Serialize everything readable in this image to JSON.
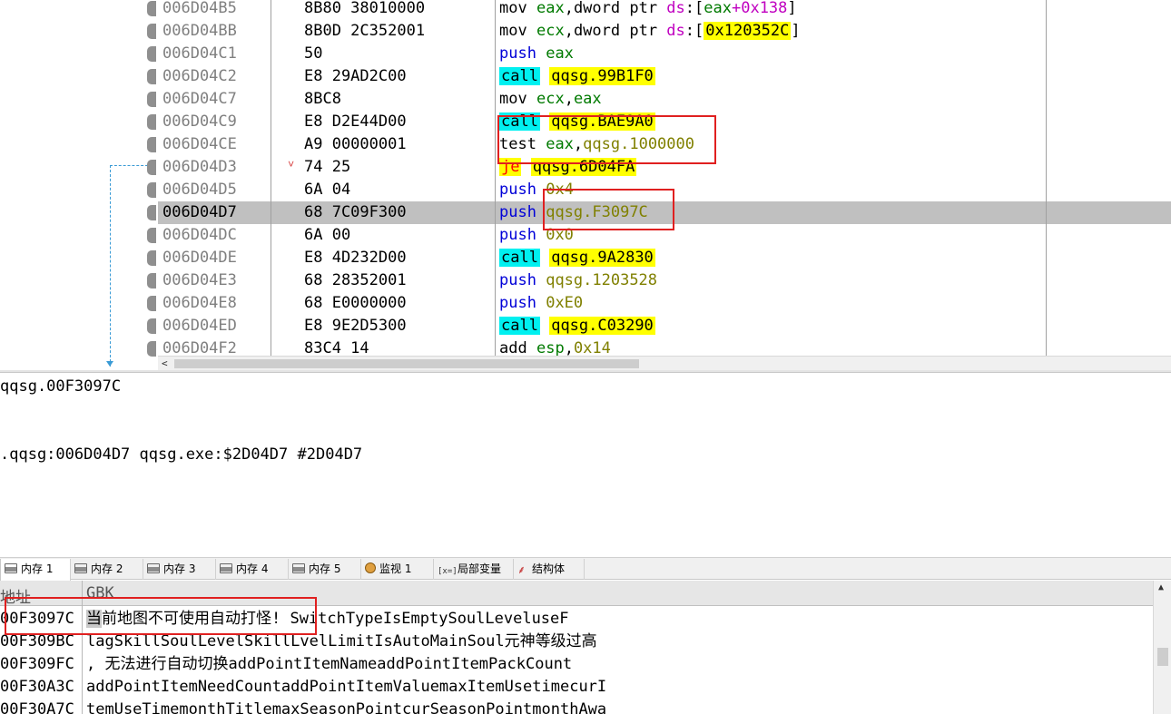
{
  "disasm": {
    "rows": [
      {
        "addr": "006D04B5",
        "bytes": "8B80 38010000",
        "mn": "mov",
        "mn_style": "plain",
        "ops": [
          [
            "eax",
            "reg"
          ],
          [
            ",",
            "br"
          ],
          [
            "dword ptr ",
            "br"
          ],
          [
            "ds",
            "seg"
          ],
          [
            ":[",
            "br"
          ],
          [
            "eax",
            "reg"
          ],
          [
            "+0x138",
            "seg"
          ],
          [
            "]",
            "br"
          ]
        ]
      },
      {
        "addr": "006D04BB",
        "bytes": "8B0D 2C352001",
        "mn": "mov",
        "mn_style": "plain",
        "ops": [
          [
            "ecx",
            "reg"
          ],
          [
            ",",
            "br"
          ],
          [
            "dword ptr ",
            "br"
          ],
          [
            "ds",
            "seg"
          ],
          [
            ":[",
            "br"
          ],
          [
            "0x120352C",
            "sym-y"
          ],
          [
            "]",
            "br"
          ]
        ]
      },
      {
        "addr": "006D04C1",
        "bytes": "50",
        "mn": "push",
        "mn_style": "push",
        "ops": [
          [
            "eax",
            "reg"
          ]
        ]
      },
      {
        "addr": "006D04C2",
        "bytes": "E8 29AD2C00",
        "mn": "call",
        "mn_style": "call",
        "ops": [
          [
            "qqsg.99B1F0",
            "sym-y"
          ]
        ]
      },
      {
        "addr": "006D04C7",
        "bytes": "8BC8",
        "mn": "mov",
        "mn_style": "plain",
        "ops": [
          [
            "ecx",
            "reg"
          ],
          [
            ",",
            "br"
          ],
          [
            "eax",
            "reg"
          ]
        ]
      },
      {
        "addr": "006D04C9",
        "bytes": "E8 D2E44D00",
        "mn": "call",
        "mn_style": "call",
        "ops": [
          [
            "qqsg.BAE9A0",
            "sym-y"
          ]
        ]
      },
      {
        "addr": "006D04CE",
        "bytes": "A9 00000001",
        "mn": "test",
        "mn_style": "plain",
        "ops": [
          [
            "eax",
            "reg"
          ],
          [
            ",",
            "br"
          ],
          [
            "qqsg.1000000",
            "sym-o"
          ]
        ]
      },
      {
        "addr": "006D04D3",
        "bytes": "74 25",
        "mn": "je",
        "mn_style": "jmp",
        "arrow": "˅",
        "ops": [
          [
            "qqsg.6D04FA",
            "sym-y"
          ]
        ]
      },
      {
        "addr": "006D04D5",
        "bytes": "6A 04",
        "mn": "push",
        "mn_style": "push",
        "ops": [
          [
            "0x4",
            "imm"
          ]
        ]
      },
      {
        "addr": "006D04D7",
        "bytes": "68 7C09F300",
        "mn": "push",
        "mn_style": "push",
        "selected": true,
        "ops": [
          [
            "qqsg.F3097C",
            "sym-o"
          ]
        ]
      },
      {
        "addr": "006D04DC",
        "bytes": "6A 00",
        "mn": "push",
        "mn_style": "push",
        "ops": [
          [
            "0x0",
            "imm"
          ]
        ]
      },
      {
        "addr": "006D04DE",
        "bytes": "E8 4D232D00",
        "mn": "call",
        "mn_style": "call",
        "ops": [
          [
            "qqsg.9A2830",
            "sym-y"
          ]
        ]
      },
      {
        "addr": "006D04E3",
        "bytes": "68 28352001",
        "mn": "push",
        "mn_style": "push",
        "ops": [
          [
            "qqsg.1203528",
            "sym-o"
          ]
        ]
      },
      {
        "addr": "006D04E8",
        "bytes": "68 E0000000",
        "mn": "push",
        "mn_style": "push",
        "ops": [
          [
            "0xE0",
            "imm"
          ]
        ]
      },
      {
        "addr": "006D04ED",
        "bytes": "E8 9E2D5300",
        "mn": "call",
        "mn_style": "call",
        "ops": [
          [
            "qqsg.C03290",
            "sym-y"
          ]
        ]
      },
      {
        "addr": "006D04F2",
        "bytes": "83C4 14",
        "mn": "add",
        "mn_style": "plain",
        "ops": [
          [
            "esp",
            "reg"
          ],
          [
            ",",
            "br"
          ],
          [
            "0x14",
            "imm"
          ]
        ]
      }
    ]
  },
  "info": {
    "line1": "qqsg.00F3097C",
    "line2": ".qqsg:006D04D7 qqsg.exe:$2D04D7 #2D04D7"
  },
  "tabs": [
    {
      "label": "内存 1",
      "icon": "memory-icon",
      "active": true
    },
    {
      "label": "内存 2",
      "icon": "memory-icon"
    },
    {
      "label": "内存 3",
      "icon": "memory-icon"
    },
    {
      "label": "内存 4",
      "icon": "memory-icon"
    },
    {
      "label": "内存 5",
      "icon": "memory-icon"
    },
    {
      "label": "监视 1",
      "icon": "watch-icon"
    },
    {
      "label": "局部变量",
      "icon": "locals-icon",
      "icon_text": "[x=]"
    },
    {
      "label": "结构体",
      "icon": "struct-icon",
      "icon_text": "⸙"
    }
  ],
  "dump": {
    "header_addr": "地址",
    "header_text": "GBK",
    "rows": [
      {
        "addr": "00F3097C",
        "cursor_char": "当",
        "text": "前地图不可使用自动打怪! SwitchTypeIsEmptySoulLeveluseF"
      },
      {
        "addr": "00F309BC",
        "cursor_char": "",
        "text": "lagSkillSoulLevelSkillLvelLimitIsAutoMainSoul元神等级过高"
      },
      {
        "addr": "00F309FC",
        "cursor_char": "",
        "text": ", 无法进行自动切换addPointItemNameaddPointItemPackCount"
      },
      {
        "addr": "00F30A3C",
        "cursor_char": "",
        "text": "addPointItemNeedCountaddPointItemValuemaxItemUsetimecurI"
      },
      {
        "addr": "00F30A7C",
        "cursor_char": "",
        "text": "temUseTimemonthTitlemaxSeasonPointcurSeasonPointmonthAwa"
      }
    ]
  },
  "colors": {
    "call_bg": "#00f0f0",
    "symbol_bg": "#ffff00",
    "jump_fg": "#ff0000",
    "register": "#007a00",
    "push": "#0000d8",
    "segment": "#c000c0",
    "immediate": "#808000",
    "highlight_box": "#e02020",
    "selected_row": "#c0c0c0"
  }
}
